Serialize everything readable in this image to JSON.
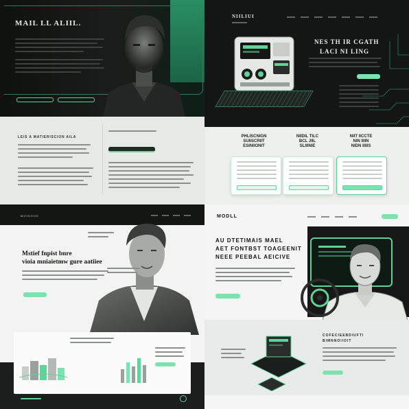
{
  "q1": {
    "hero_title": "MAIL LL ALIIL.",
    "section_title": "LEIS A MATIERISCION AILA",
    "buttons": [
      "",
      "",
      ""
    ]
  },
  "q2": {
    "brand": "NIILIUI",
    "brand_sub": "",
    "hero_title_line1": "NES TH IR CGATH",
    "hero_title_line2": "LACI NI LING",
    "cards": [
      {
        "title": "PHLISCNIGN\nSUIISCRIIT\nESINIIONIT"
      },
      {
        "title": "NIIDIL TILC\nBCL JIIL\nSLIIINIE"
      },
      {
        "title": "NIIT IICCTE\nNIN IIIIN\nNIDN IIIIIS"
      }
    ]
  },
  "q3": {
    "nav_brand": "MOINGOD",
    "hero_line1": "Mstief fnpist bnre",
    "hero_line2": "vioia mniaietmw gure aatiiee"
  },
  "q4": {
    "brand": "MODLL",
    "hero_line1": "AU DTETIMAIS MAEL",
    "hero_line2": "AET FONTBST TOAGEENIT",
    "hero_line3": "NEEE PEEBAL AEICIVE",
    "section_title_line1": "COFECIEEBDIUFTI",
    "section_title_line2": "BIMNNOIIOIT"
  },
  "colors": {
    "accent": "#5fd39a",
    "dark": "#151715"
  }
}
